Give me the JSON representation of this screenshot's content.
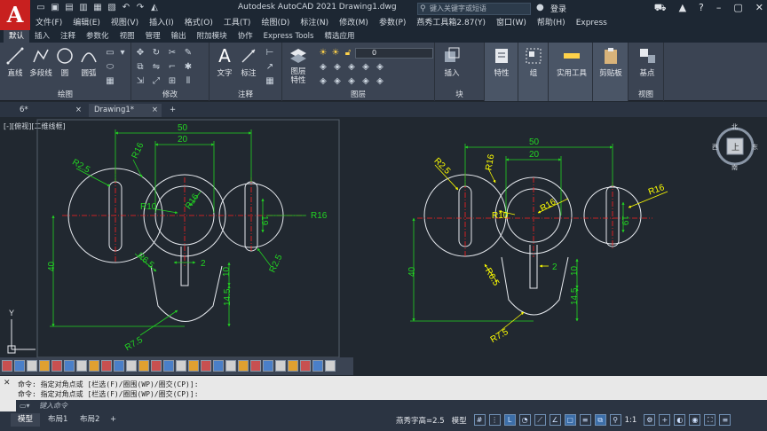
{
  "titlebar": {
    "app_logo": "A",
    "title": "Autodesk AutoCAD 2021    Drawing1.dwg",
    "search_placeholder": "键入关键字或短语",
    "login": "登录"
  },
  "menus": [
    "文件(F)",
    "编辑(E)",
    "视图(V)",
    "插入(I)",
    "格式(O)",
    "工具(T)",
    "绘图(D)",
    "标注(N)",
    "修改(M)",
    "参数(P)",
    "燕秀工具箱2.87(Y)",
    "窗口(W)",
    "帮助(H)",
    "Express"
  ],
  "ribbon_tabs": [
    "默认",
    "插入",
    "注释",
    "参数化",
    "视图",
    "管理",
    "输出",
    "附加模块",
    "协作",
    "Express Tools",
    "精选应用"
  ],
  "ribbon": {
    "draw": {
      "title": "绘图",
      "line": "直线",
      "polyline": "多段线",
      "circle": "圆",
      "arc": "圆弧"
    },
    "modify": {
      "title": "修改"
    },
    "annotation": {
      "title": "注释",
      "text": "文字",
      "dimension": "标注"
    },
    "layers": {
      "title": "图层",
      "properties": "图层\n特性",
      "current_layer": "0"
    },
    "block": {
      "title": "块",
      "insert": "插入"
    },
    "properties": {
      "label": "特性"
    },
    "groups": {
      "label": "组"
    },
    "utilities": {
      "label": "实用工具"
    },
    "clipboard": {
      "label": "剪贴板"
    },
    "view": {
      "title": "视图",
      "base": "基点"
    }
  },
  "file_tabs": [
    "6*",
    "Drawing1*"
  ],
  "viewport_label": "[-][俯视][二维线框]",
  "viewcube": {
    "n": "北",
    "s": "南",
    "e": "东",
    "w": "西",
    "face": "上"
  },
  "ucs": {
    "y": "Y",
    "x": "X"
  },
  "dimensions": {
    "d50": "50",
    "d20": "20",
    "r16a": "R16",
    "r25a": "R2.5",
    "r10": "R10",
    "r16b": "R16",
    "r16c": "R16",
    "d19": "19",
    "d2": "2",
    "r65": "R6.5",
    "r25b": "R2.5",
    "d40": "40",
    "d10": "10",
    "d145": "14.5",
    "r75": "R7.5"
  },
  "command_history": [
    "命令: 指定对角点或 [栏选(F)/圈围(WP)/圈交(CP)]:",
    "命令: 指定对角点或 [栏选(F)/圈围(WP)/圈交(CP)]:"
  ],
  "command_placeholder": "键入命令",
  "layout_tabs": [
    "模型",
    "布局1",
    "布局2"
  ],
  "statusbar": {
    "text_height": "燕秀字高=2.5",
    "model": "模型",
    "scale": "1:1"
  },
  "colors": {
    "accent_green": "#22d422",
    "center_red": "#ff2020",
    "dim_yellow": "#ffff00"
  }
}
